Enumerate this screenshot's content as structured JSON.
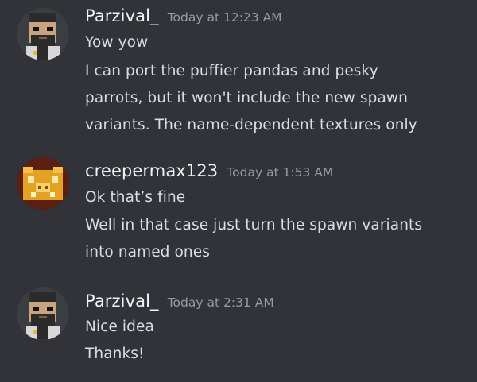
{
  "messages": [
    {
      "username": "Parzival_",
      "timestamp": "Today at 12:23 AM",
      "avatar_icon": "bearded-blocky-character-avatar",
      "lines": [
        "Yow yow",
        "I can port the puffier pandas and pesky",
        "parrots, but it won't include the new spawn",
        "variants. The name-dependent textures only"
      ]
    },
    {
      "username": "creepermax123",
      "timestamp": "Today at 1:53 AM",
      "avatar_icon": "golden-pig-face-avatar",
      "lines": [
        "Ok that’s fine",
        "Well in that case just turn the spawn variants",
        "into named ones"
      ]
    },
    {
      "username": "Parzival_",
      "timestamp": "Today at 2:31 AM",
      "avatar_icon": "bearded-blocky-character-avatar",
      "lines": [
        "Nice idea",
        "Thanks!"
      ]
    }
  ],
  "colors": {
    "background": "#313338",
    "username": "#f2f3f5",
    "timestamp": "#949ba4",
    "message_text": "#dbdee1"
  }
}
